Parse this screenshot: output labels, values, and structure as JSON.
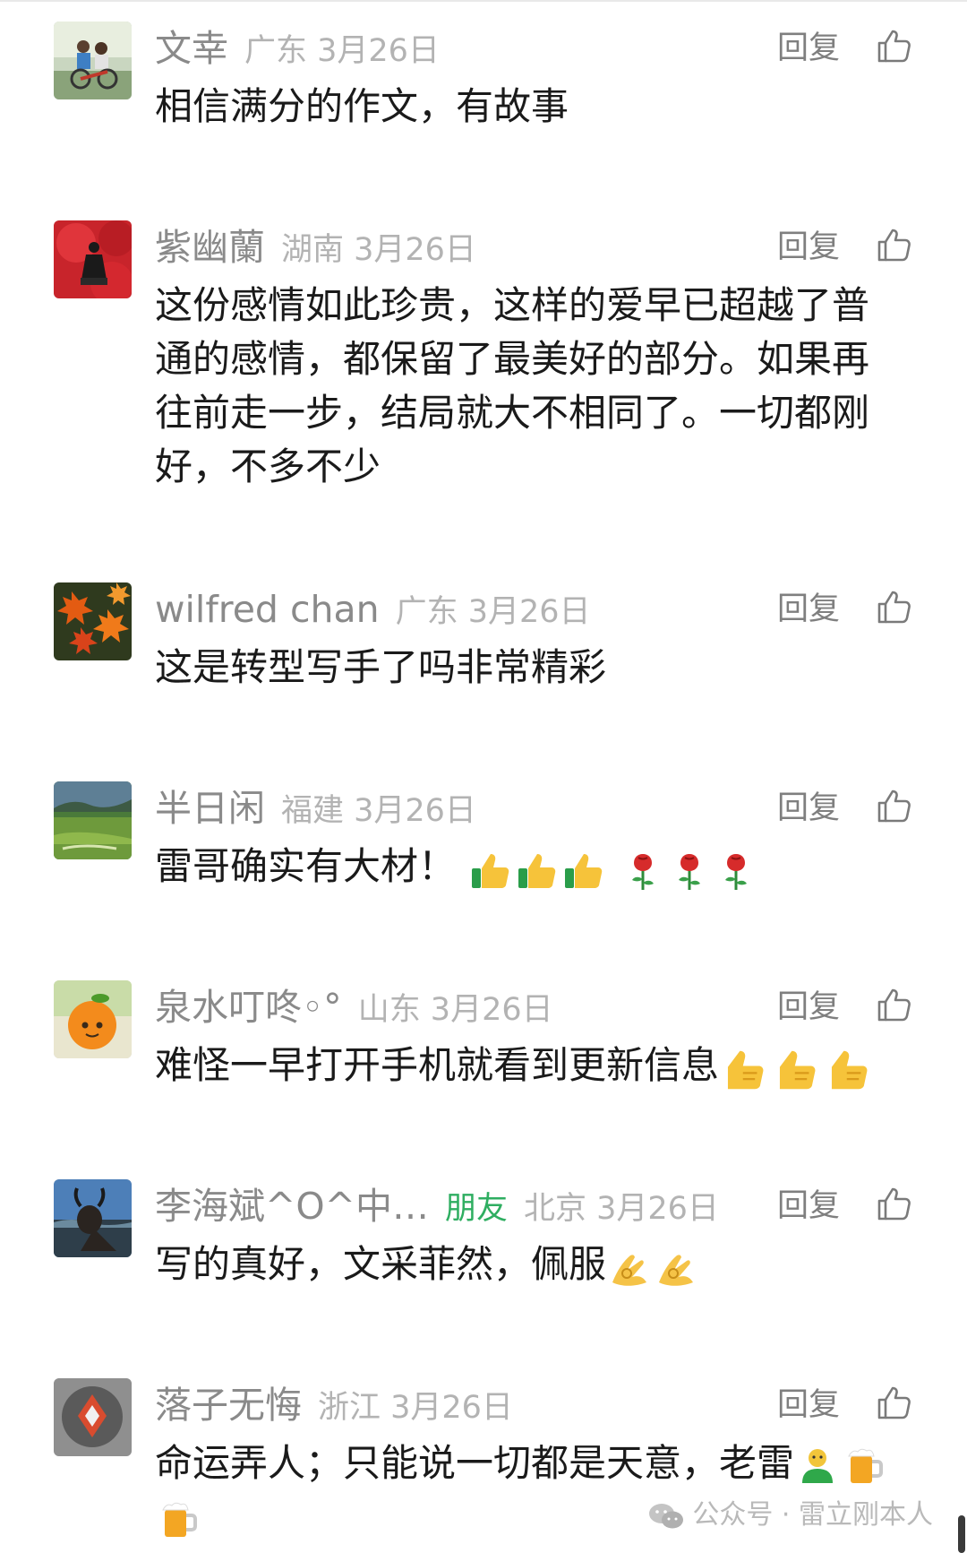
{
  "comments": [
    {
      "avatar": "avatar-kids-on-bike",
      "username": "文幸",
      "friend_tag": "",
      "location": "广东",
      "date": "3月26日",
      "reply_label": "回复",
      "content": "相信满分的作文，有故事",
      "emojis": []
    },
    {
      "avatar": "avatar-red-flower-figure",
      "username": "紫幽蘭",
      "friend_tag": "",
      "location": "湖南",
      "date": "3月26日",
      "reply_label": "回复",
      "content": "这份感情如此珍贵，这样的爱早已超越了普通的感情，都保留了最美好的部分。如果再往前走一步，结局就大不相同了。一切都刚好，不多不少",
      "emojis": []
    },
    {
      "avatar": "avatar-maple-leaves",
      "username": "wilfred chan",
      "friend_tag": "",
      "location": "广东",
      "date": "3月26日",
      "reply_label": "回复",
      "content": "这是转型写手了吗非常精彩",
      "emojis": []
    },
    {
      "avatar": "avatar-green-landscape",
      "username": "半日闲",
      "friend_tag": "",
      "location": "福建",
      "date": "3月26日",
      "reply_label": "回复",
      "content": "雷哥确实有大材！",
      "emojis": [
        "thumbs-up-emoji",
        "thumbs-up-emoji",
        "thumbs-up-emoji",
        "rose-emoji",
        "rose-emoji",
        "rose-emoji"
      ]
    },
    {
      "avatar": "avatar-orange-fruit",
      "username": "泉水叮咚◦°",
      "friend_tag": "",
      "location": "山东",
      "date": "3月26日",
      "reply_label": "回复",
      "content": "难怪一早打开手机就看到更新信息",
      "emojis": [
        "thumbs-up-emoji",
        "thumbs-up-emoji",
        "thumbs-up-emoji"
      ]
    },
    {
      "avatar": "avatar-bull-statue",
      "username": "李海斌^O^中…",
      "friend_tag": "朋友",
      "location": "北京",
      "date": "3月26日",
      "reply_label": "回复",
      "content": "写的真好，文采菲然，佩服",
      "emojis": [
        "ok-hand-emoji",
        "ok-hand-emoji"
      ]
    },
    {
      "avatar": "avatar-gray-badge",
      "username": "落子无悔",
      "friend_tag": "",
      "location": "浙江",
      "date": "3月26日",
      "reply_label": "回复",
      "content": "命运弄人；只能说一切都是天意，老雷",
      "emojis": [
        "person-emoji",
        "beer-mug-emoji",
        "beer-mug-emoji"
      ]
    }
  ],
  "icons": {
    "like": "thumbs-up-outline-icon",
    "watermark": "wechat-icon"
  },
  "watermark": {
    "text": "公众号 · 雷立刚本人"
  },
  "colors": {
    "username": "#8a8a8a",
    "meta": "#b3b3b3",
    "friend_tag": "#2fae61",
    "content": "#1a1a1a",
    "reply": "#7f7f7f"
  }
}
